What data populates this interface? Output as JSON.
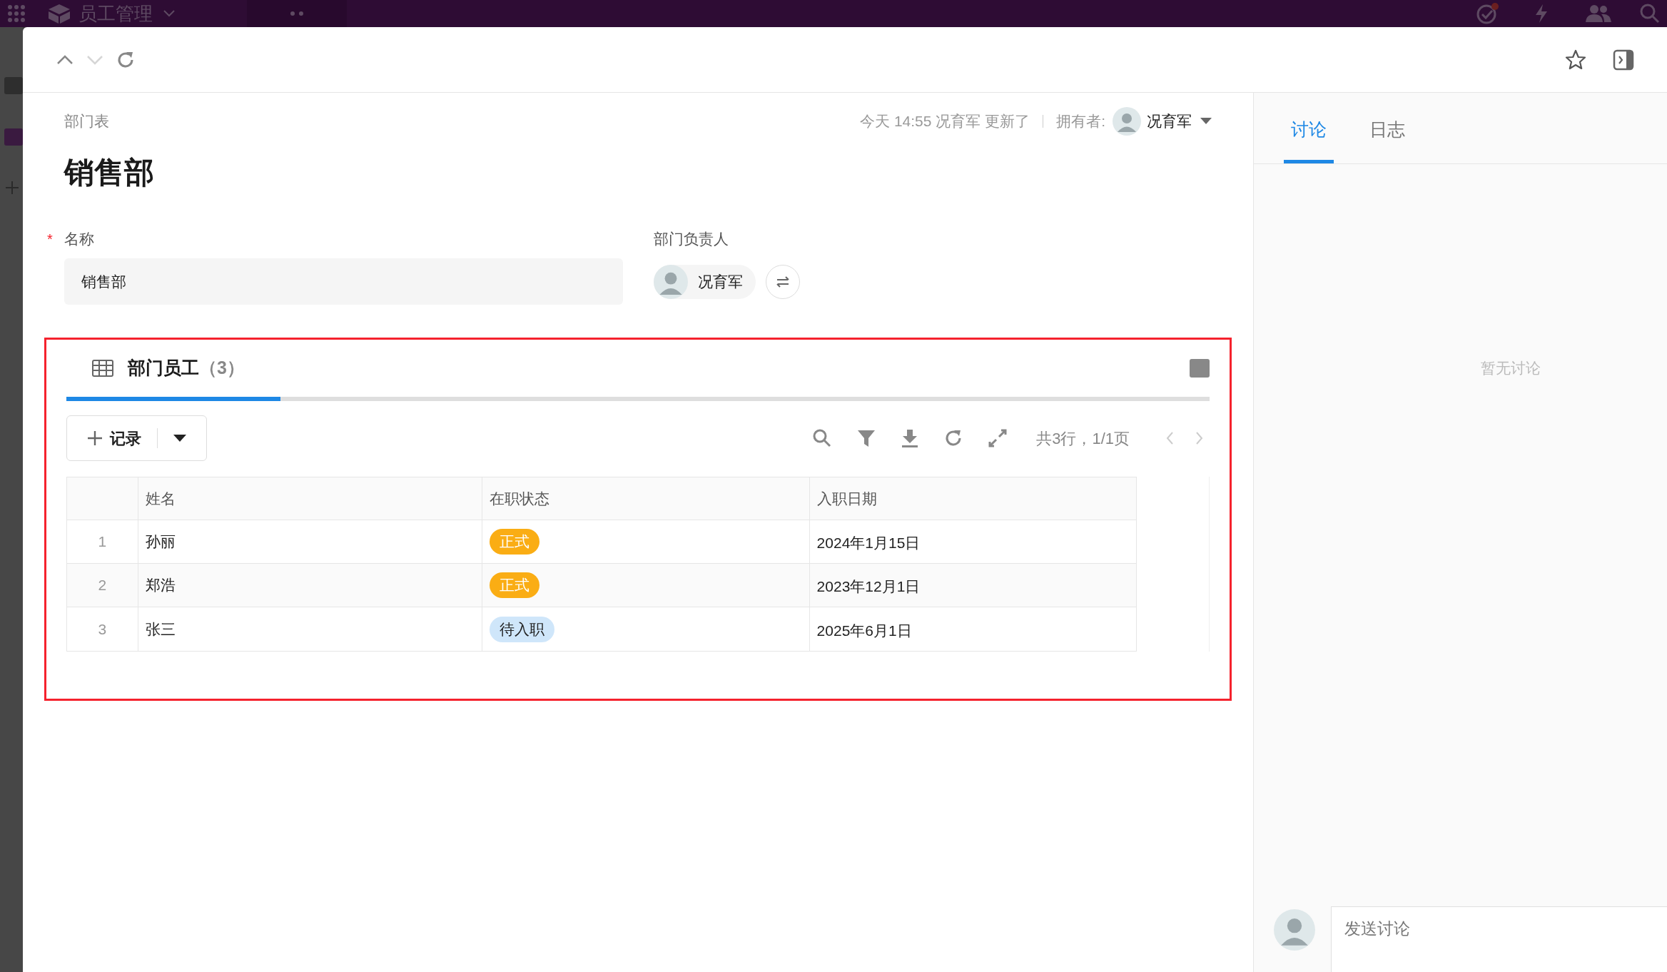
{
  "app_bar": {
    "title": "员工管理"
  },
  "record": {
    "breadcrumb": "部门表",
    "updated": "今天 14:55 况育军 更新了",
    "owner_label": "拥有者:",
    "owner": "况育军",
    "title": "销售部",
    "fields": [
      {
        "kind": "text",
        "label": "名称",
        "required_mark": "*",
        "value": "销售部"
      },
      {
        "kind": "user",
        "label": "部门负责人",
        "value": "况育军"
      }
    ]
  },
  "subtable": {
    "highlighted": true,
    "tabs": [
      {
        "label": "部门员工",
        "count": "（3）",
        "selected": true
      }
    ],
    "add_button": "记录",
    "pagination": "共3行，1/1页",
    "columns": [
      "姓名",
      "在职状态",
      "入职日期"
    ],
    "rows": [
      {
        "index": "1",
        "name": "孙丽",
        "status": {
          "label": "正式",
          "color": "#faad14"
        },
        "hire_date": "2024年1月15日"
      },
      {
        "index": "2",
        "name": "郑浩",
        "status": {
          "label": "正式",
          "color": "#faad14"
        },
        "hire_date": "2023年12月1日"
      },
      {
        "index": "3",
        "name": "张三",
        "status": {
          "label": "待入职",
          "color": "#cfe6fa"
        },
        "hire_date": "2025年6月1日"
      }
    ]
  },
  "discussion": {
    "tabs": [
      {
        "label": "讨论",
        "selected": true
      },
      {
        "label": "日志",
        "selected": false
      }
    ],
    "empty": "暂无讨论",
    "composer": {
      "placeholder": "发送讨论"
    }
  }
}
